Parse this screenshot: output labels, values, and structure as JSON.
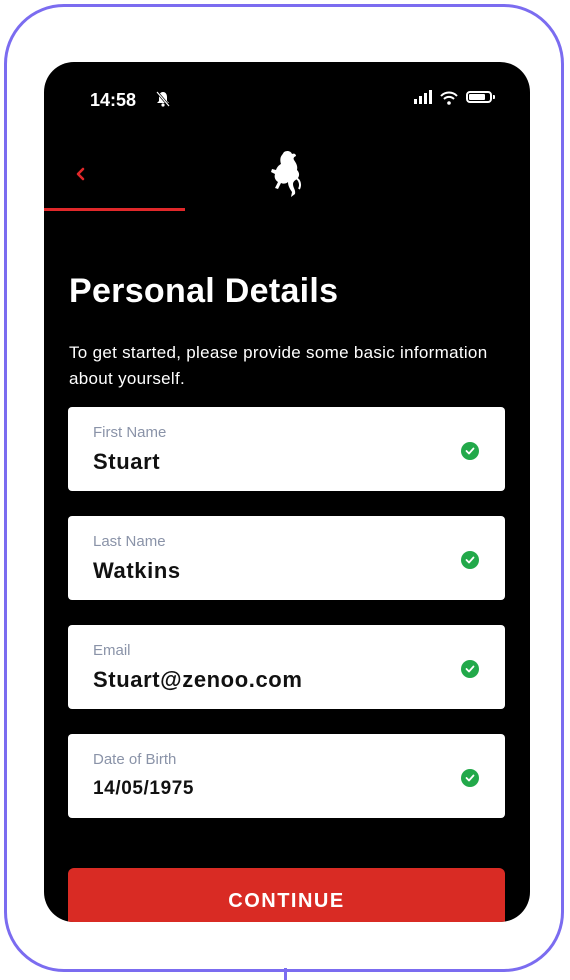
{
  "status_bar": {
    "time": "14:58"
  },
  "header": {
    "progress_fraction": 0.29,
    "accent_color": "#e0282a"
  },
  "page": {
    "title": "Personal Details",
    "subtitle": "To get started, please provide some basic information about yourself."
  },
  "fields": [
    {
      "label": "First Name",
      "value": "Stuart",
      "valid": true
    },
    {
      "label": "Last Name",
      "value": "Watkins",
      "valid": true
    },
    {
      "label": "Email",
      "value": "Stuart@zenoo.com",
      "valid": true
    },
    {
      "label": "Date of Birth",
      "value": "14/05/1975",
      "valid": true
    }
  ],
  "actions": {
    "continue_label": "CONTINUE",
    "button_color": "#d92b24"
  },
  "icons": {
    "back": "chevron-left-icon",
    "logo": "prancing-horse-logo",
    "valid": "check-circle-icon"
  }
}
